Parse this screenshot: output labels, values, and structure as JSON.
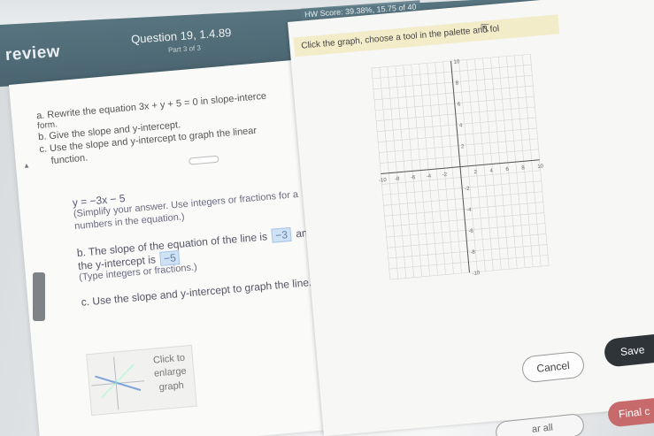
{
  "header": {
    "hw_score": "HW Score: 39.38%, 15.75 of 40",
    "section": "review",
    "question_title": "Question 19, 1.4.89",
    "question_part": "Part 3 of 3"
  },
  "instructions": "Click the graph, choose a tool in the palette and fol",
  "question": {
    "a": "a. Rewrite the equation 3x + y + 5 = 0 in slope-interce",
    "a_cont": "form.",
    "b": "b. Give the slope and y-intercept.",
    "c": "c. Use the slope and y-intercept to graph the linear",
    "c_cont": "function."
  },
  "answers": {
    "y_equation": "y = −3x − 5",
    "simplify_1": "(Simplify your answer. Use integers or fractions for a",
    "simplify_2": "numbers in the equation.)",
    "slope_prefix": "b. The slope of the equation of the line is",
    "slope_value": "−3",
    "slope_suffix": "and",
    "intercept_prefix": "the y-intercept is",
    "intercept_value": "−5",
    "type_hint": "(Type integers or fractions.)",
    "part_c": "c. Use the slope and y-intercept to graph the line."
  },
  "enlarge": {
    "line1": "Click to",
    "line2": "enlarge",
    "line3": "graph"
  },
  "buttons": {
    "cancel": "Cancel",
    "save": "Save",
    "final": "Final c",
    "bottom": "ar all"
  },
  "graph": {
    "x_min": -10,
    "x_max": 10,
    "y_min": -10,
    "y_max": 10,
    "tick_labels": [
      "10",
      "8",
      "6",
      "4",
      "2",
      "-2",
      "-4",
      "-6",
      "-8",
      "-10"
    ]
  }
}
